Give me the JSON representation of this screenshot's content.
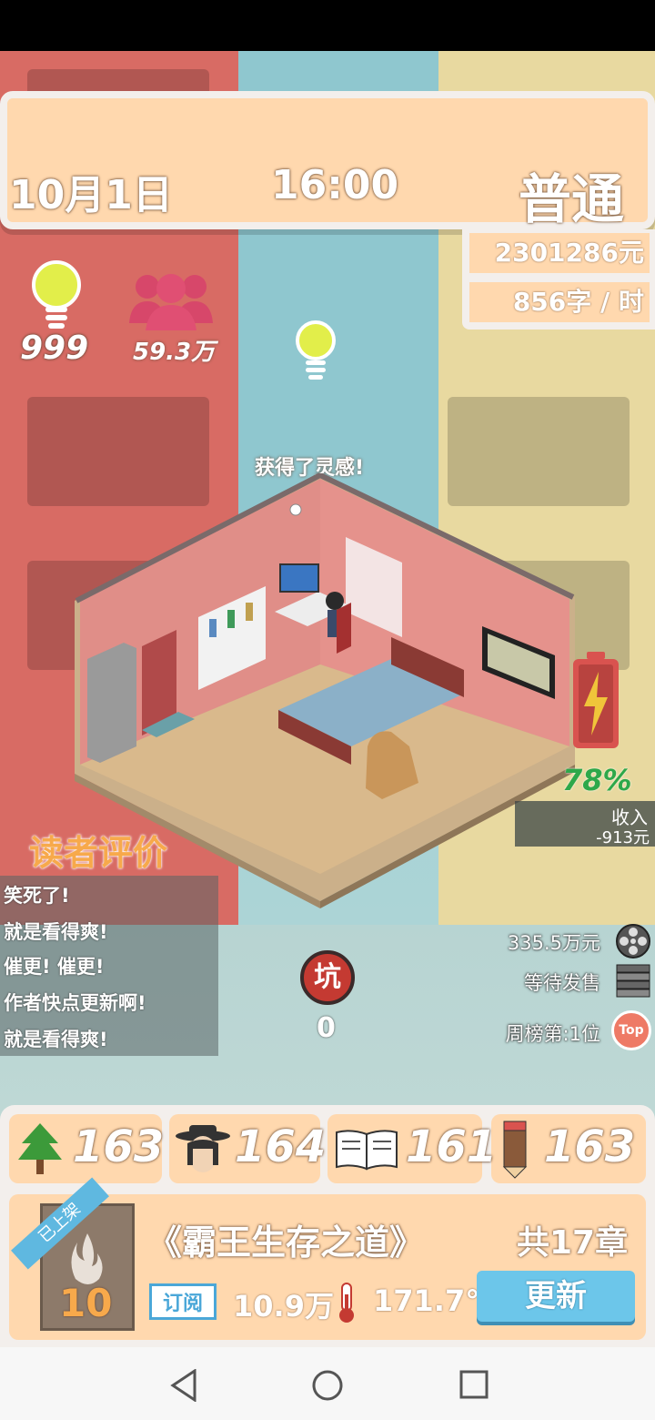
{
  "header": {
    "date": "10月1日",
    "time": "16:00",
    "difficulty": "普通"
  },
  "finance": {
    "money": "2301286元",
    "speed": "856字 / 时"
  },
  "stats": {
    "ideas": "999",
    "fans": "59.3万"
  },
  "status_text": "获得了灵感!",
  "battery": {
    "percent": "78%",
    "level": 0.78
  },
  "income": {
    "label": "收入",
    "value": "-913元"
  },
  "reviews": {
    "title": "读者评价",
    "items": [
      "笑死了!",
      "就是看得爽!",
      "催更! 催更!",
      "作者快点更新啊!",
      "就是看得爽!"
    ]
  },
  "pit": {
    "label": "坑",
    "count": "0"
  },
  "sales": {
    "film_value": "335.5万元",
    "book_status": "等待发售",
    "weekly_rank": "周榜第:1位",
    "top_badge": "Top"
  },
  "attributes": [
    {
      "icon": "tree-icon",
      "value": "163"
    },
    {
      "icon": "character-icon",
      "value": "164"
    },
    {
      "icon": "open-book-icon",
      "value": "161"
    },
    {
      "icon": "pencil-icon",
      "value": "163"
    }
  ],
  "book": {
    "ribbon": "已上架",
    "cover_number": "10",
    "title": "《霸王生存之道》",
    "chapters": "共17章",
    "subscribe_label": "订阅",
    "subscribers": "10.9万",
    "heat": "171.7°",
    "update_button": "更新"
  },
  "colors": {
    "panel": "#ffd8ae",
    "frame": "#f3efec",
    "accent_blue": "#6cc6ea",
    "battery_red": "#d9534f",
    "percent_green": "#2ea84a",
    "reviews_title": "#f7a94b"
  }
}
